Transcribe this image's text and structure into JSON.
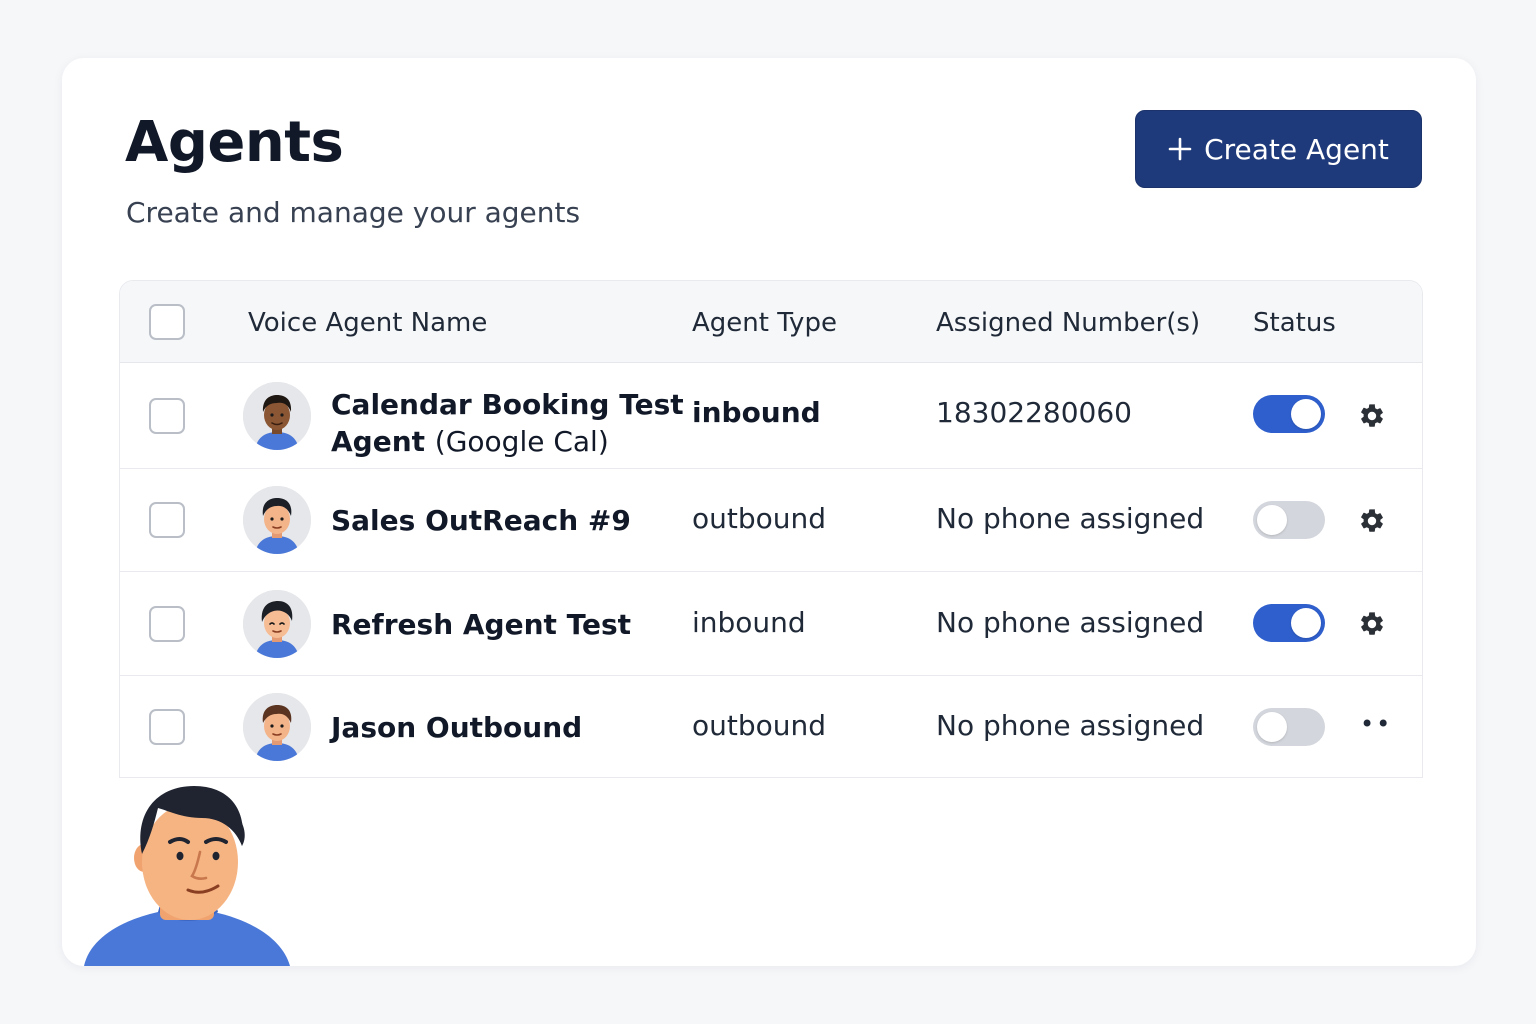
{
  "header": {
    "title": "Agents",
    "subtitle": "Create and manage your agents",
    "create_button_label": "Create Agent",
    "create_button_icon": "plus-icon"
  },
  "table": {
    "columns": {
      "select": "",
      "name": "Voice Agent Name",
      "type": "Agent Type",
      "numbers": "Assigned Number(s)",
      "status": "Status"
    },
    "rows": [
      {
        "name": "Calendar Booking Test",
        "name_line2": "Agent",
        "name_suffix": "(Google Cal)",
        "type": "inbound",
        "number": "18302280060",
        "status_enabled": true,
        "action_icon": "gear-icon"
      },
      {
        "name": "Sales OutReach #9",
        "type": "outbound",
        "number": "No phone assigned",
        "status_enabled": false,
        "action_icon": "gear-icon"
      },
      {
        "name": "Refresh Agent Test",
        "type": "inbound",
        "number": "No phone assigned",
        "status_enabled": true,
        "action_icon": "gear-icon"
      },
      {
        "name": "Jason Outbound",
        "type": "outbound",
        "number": "No phone assigned",
        "status_enabled": false,
        "action_icon": "more-dots-icon",
        "action_glyph": "••"
      }
    ]
  },
  "colors": {
    "primary": "#1f3a7a",
    "toggle_on": "#2f5fcc",
    "toggle_off": "#d3d6dc",
    "avatar_shirt": "#4a78d8"
  }
}
